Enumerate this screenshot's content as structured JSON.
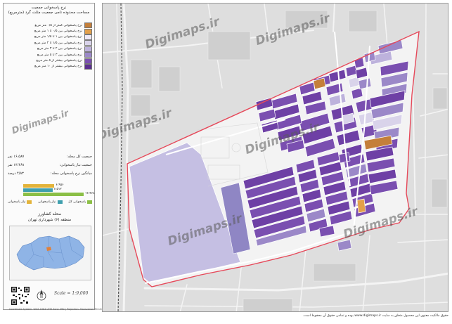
{
  "legend": {
    "title": "نرخ پاسخوانی جمعیت",
    "subtitle": "مساحت محدوده نامی جمعیت مثلث گرد (مترمربع)",
    "classes": [
      {
        "label": "نرخ پاسخوانی کمتر از ۰/۵ متر مربع",
        "color": "#c47f3a"
      },
      {
        "label": "نرخ پاسخوانی بین ۰/۵ تا ۱ متر مربع",
        "color": "#e3a04a"
      },
      {
        "label": "نرخ پاسخوانی بین ۱ تا ۱/۵ متر مربع",
        "color": "#efe9f6"
      },
      {
        "label": "نرخ پاسخوانی بین ۱/۵ تا ۲ متر مربع",
        "color": "#d9d3ea"
      },
      {
        "label": "نرخ پاسخوانی بین ۲ تا ۳ متر مربع",
        "color": "#bdb2dc"
      },
      {
        "label": "نرخ پاسخوانی بین ۳ تا ۵ متر مربع",
        "color": "#9b88c8"
      },
      {
        "label": "نرخ پاسخوانی بیشتر از ۵ متر مربع",
        "color": "#7a4fb0"
      },
      {
        "label": "نرخ پاسخوانی بیشتر از ۱۰ متر مربع",
        "color": "#5b2f8f"
      }
    ]
  },
  "stats": [
    {
      "label": "جمعیت کل محله:",
      "value": "۱۶،۵۸۷ نفر"
    },
    {
      "label": "جمعیت نیاز پاسخوانی:",
      "value": "۱۳،۴۶۸ نفر"
    },
    {
      "label": "میانگین نرخ پاسخوانی محله:",
      "value": "۴/۸۳ درصد"
    }
  ],
  "bar_values": [
    {
      "label": "۶،۹۵۶",
      "value": 6956,
      "color": "#e3b33a"
    },
    {
      "label": "۶،۵۱۲",
      "value": 6512,
      "color": "#3f9fae"
    },
    {
      "label": "۱۳،۴۶۸",
      "value": 13468,
      "color": "#8bbf46"
    }
  ],
  "land_legend": [
    {
      "label": "پاسخوانی کل",
      "color": "#8bbf46"
    },
    {
      "label": "نیاز پاسخوانی",
      "color": "#3f9fae"
    },
    {
      "label": "نیاز پاسخوانی",
      "color": "#e3b33a"
    }
  ],
  "neighborhood": "محله کشاورز",
  "zone": "منطقه (۶) شهرداری تهران",
  "scale": "Scale = 1:9,000",
  "coord_note": "Coordinate System: WGS 1984 UTM Zone 39N | Projection: Transverse Mercator",
  "watermark": "Digimaps.ir",
  "footer": "حقوق مالکیت معنوی این محصول متعلق به سایت www.digimaps.ir بوده و تمامی حقوق آن محفوظ است.",
  "colors": {
    "boundary": "#e6495a",
    "road": "#f5f5f5",
    "background": "#dedede"
  }
}
